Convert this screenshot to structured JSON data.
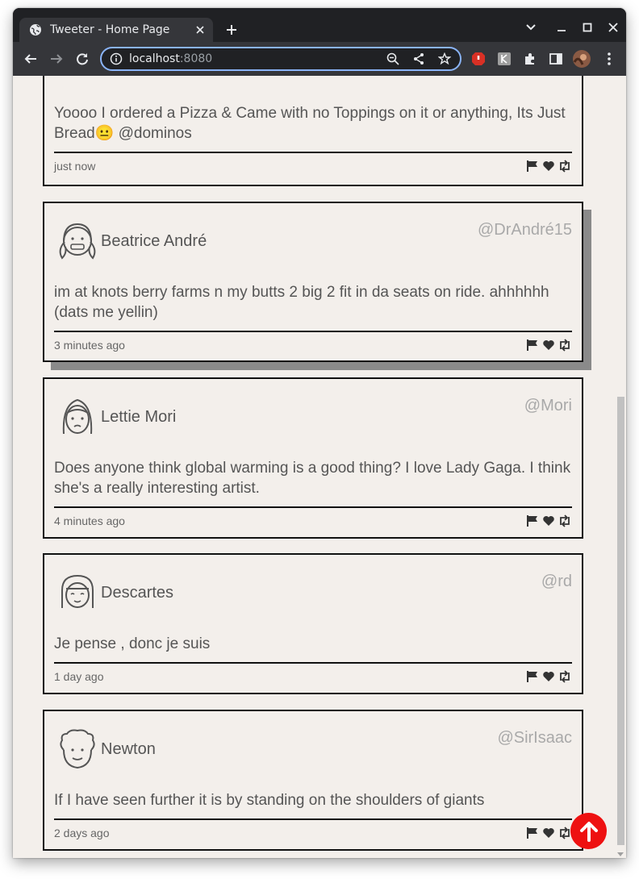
{
  "browser": {
    "tab_title": "Tweeter - Home Page",
    "url_host": "localhost",
    "url_port": ":8080"
  },
  "tweets": [
    {
      "name": "",
      "handle": "",
      "text": "Yoooo I ordered a Pizza & Came with no Toppings on it or anything, Its Just Bread😐 @dominos",
      "time": "just now"
    },
    {
      "name": "Beatrice André",
      "handle": "@DrAndré15",
      "text": "im at knots berry farms n my butts 2 big 2 fit in da seats on ride. ahhhhhh (dats me yellin)",
      "time": "3 minutes ago"
    },
    {
      "name": "Lettie Mori",
      "handle": "@Mori",
      "text": "Does anyone think global warming is a good thing? I love Lady Gaga. I think she's a really interesting artist.",
      "time": "4 minutes ago"
    },
    {
      "name": "Descartes",
      "handle": "@rd",
      "text": "Je pense , donc je suis",
      "time": "1 day ago"
    },
    {
      "name": "Newton",
      "handle": "@SirIsaac",
      "text": "If I have seen further it is by standing on the shoulders of giants",
      "time": "2 days ago"
    }
  ],
  "icons": {
    "flag": "flag-icon",
    "like": "heart-icon",
    "retweet": "retweet-icon",
    "scroll_top": "arrow-up-icon"
  },
  "colors": {
    "page_bg": "#f3efeb",
    "fab": "#ee1111",
    "omnibox_focus": "#8ab4f8"
  }
}
